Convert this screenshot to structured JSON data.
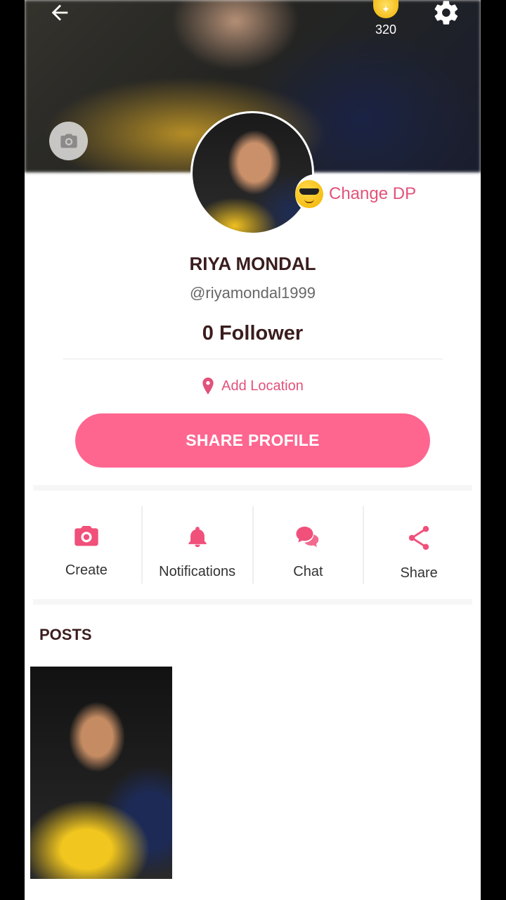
{
  "header": {
    "coins": "320"
  },
  "profile": {
    "change_dp_label": "Change DP",
    "name": "RIYA MONDAL",
    "handle": "@riyamondal1999",
    "followers": "0 Follower",
    "location_label": "Add Location",
    "share_button_label": "SHARE PROFILE"
  },
  "actions": [
    {
      "label": "Create",
      "icon": "camera-icon"
    },
    {
      "label": "Notifications",
      "icon": "bell-icon"
    },
    {
      "label": "Chat",
      "icon": "chat-icon"
    },
    {
      "label": "Share",
      "icon": "share-icon"
    }
  ],
  "posts": {
    "title": "POSTS"
  },
  "colors": {
    "accent": "#fe6690",
    "accent_text": "#e2527a",
    "title_text": "#3b1d1d"
  }
}
